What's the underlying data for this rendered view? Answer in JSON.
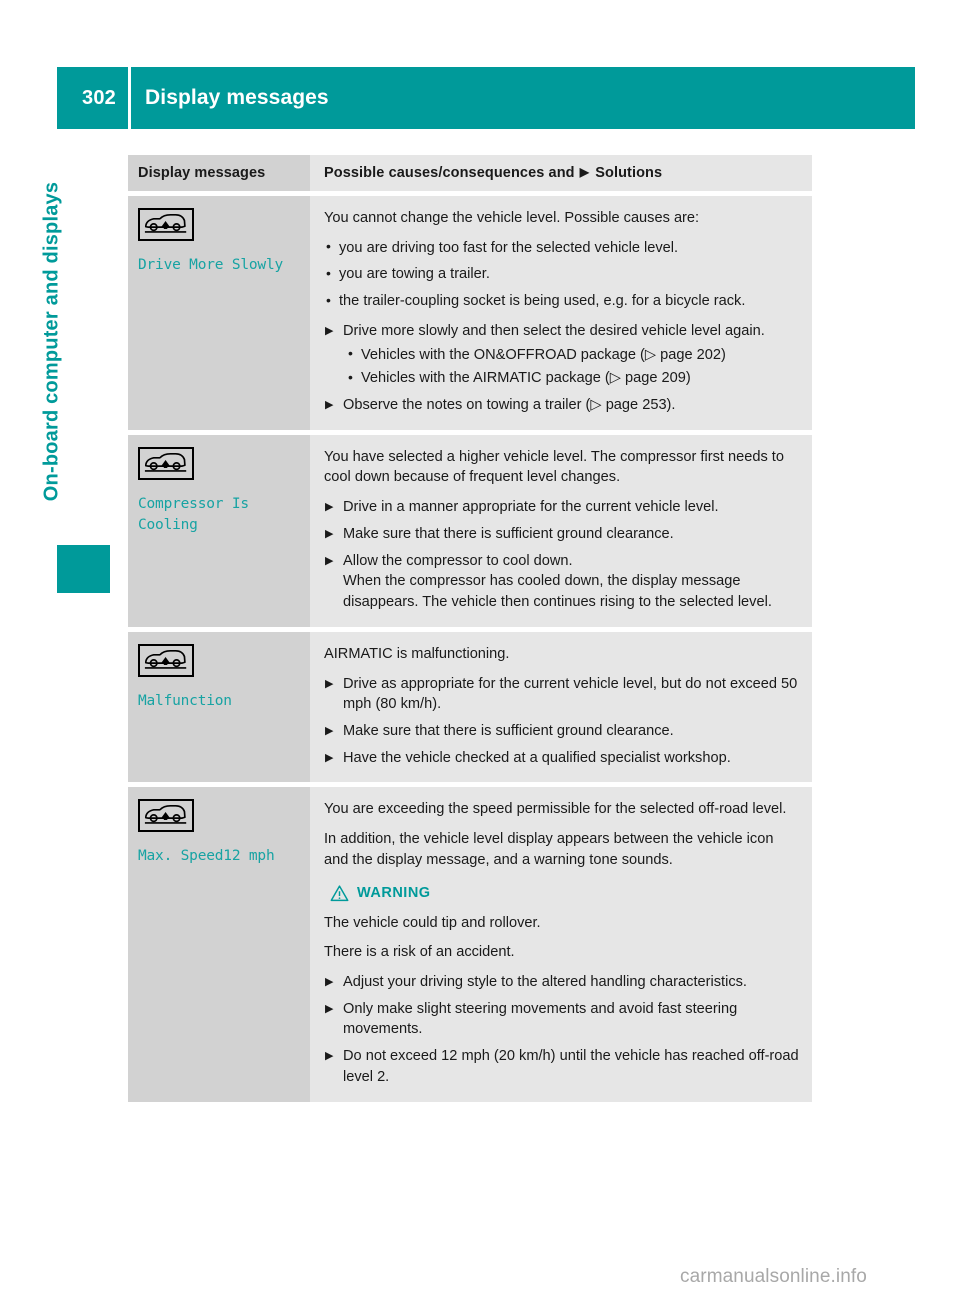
{
  "page": {
    "number": "302",
    "header_title": "Display messages",
    "sidebar_label": "On-board computer and displays",
    "watermark": "carmanualsonline.info",
    "accent_color": "#009a9a",
    "message_color": "#17a3a3"
  },
  "table": {
    "headers": {
      "left": "Display messages",
      "right_before": "Possible causes/consequences and",
      "right_after": "Solutions"
    },
    "rows": [
      {
        "icon": "vehicle-level-up-icon",
        "message": "Drive More Slowly",
        "content": [
          {
            "type": "para",
            "text": "You cannot change the vehicle level. Possible causes are:"
          },
          {
            "type": "bullets",
            "items": [
              "you are driving too fast for the selected vehicle level.",
              "you are towing a trailer.",
              "the trailer-coupling socket is being used, e.g. for a bicycle rack."
            ]
          },
          {
            "type": "steps",
            "items": [
              {
                "text": "Drive more slowly and then select the desired vehicle level again.",
                "sub": [
                  "Vehicles with the ON&OFFROAD package (▷ page 202)",
                  "Vehicles with the AIRMATIC package (▷ page 209)"
                ]
              },
              {
                "text": "Observe the notes on towing a trailer (▷ page 253)."
              }
            ]
          }
        ]
      },
      {
        "icon": "vehicle-level-up-icon",
        "message": "Compressor Is\nCooling",
        "content": [
          {
            "type": "para",
            "text": "You have selected a higher vehicle level. The compressor first needs to cool down because of frequent level changes."
          },
          {
            "type": "steps",
            "items": [
              {
                "text": "Drive in a manner appropriate for the current vehicle level."
              },
              {
                "text": "Make sure that there is sufficient ground clearance."
              },
              {
                "text": "Allow the compressor to cool down.",
                "cont": "When the compressor has cooled down, the display message disappears. The vehicle then continues rising to the selected level."
              }
            ]
          }
        ]
      },
      {
        "icon": "vehicle-level-up-icon",
        "message": "Malfunction",
        "content": [
          {
            "type": "para",
            "text": "AIRMATIC is malfunctioning."
          },
          {
            "type": "steps",
            "items": [
              {
                "text": "Drive as appropriate for the current vehicle level, but do not exceed 50 mph (80 km/h)."
              },
              {
                "text": "Make sure that there is sufficient ground clearance."
              },
              {
                "text": "Have the vehicle checked at a qualified specialist workshop."
              }
            ]
          }
        ]
      },
      {
        "icon": "vehicle-level-up-icon",
        "message": "Max. Speed12 mph",
        "content": [
          {
            "type": "para",
            "text": "You are exceeding the speed permissible for the selected off-road level."
          },
          {
            "type": "para",
            "text": "In addition, the vehicle level display appears between the vehicle icon and the display message, and a warning tone sounds."
          },
          {
            "type": "warning",
            "label": "WARNING"
          },
          {
            "type": "para",
            "text": "The vehicle could tip and rollover."
          },
          {
            "type": "para",
            "text": "There is a risk of an accident."
          },
          {
            "type": "steps",
            "items": [
              {
                "text": "Adjust your driving style to the altered handling characteristics."
              },
              {
                "text": "Only make slight steering movements and avoid fast steering movements."
              },
              {
                "text": "Do not exceed 12 mph (20 km/h) until the vehicle has reached off-road level 2."
              }
            ]
          }
        ]
      }
    ]
  }
}
